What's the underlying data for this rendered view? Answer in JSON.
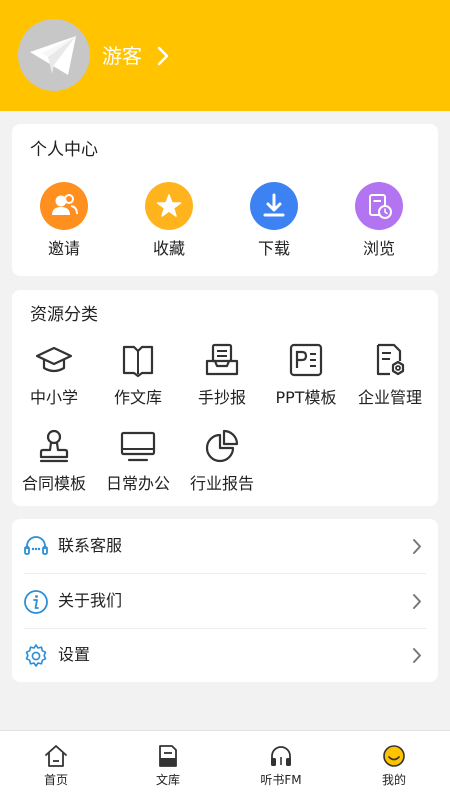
{
  "header": {
    "username": "游客"
  },
  "personal_center": {
    "title": "个人中心",
    "items": [
      {
        "label": "邀请",
        "color": "#ff8f1f"
      },
      {
        "label": "收藏",
        "color": "#ffb41e"
      },
      {
        "label": "下载",
        "color": "#3d82f2"
      },
      {
        "label": "浏览",
        "color": "#b274f0"
      }
    ]
  },
  "resources": {
    "title": "资源分类",
    "items": [
      {
        "label": "中小学"
      },
      {
        "label": "作文库"
      },
      {
        "label": "手抄报"
      },
      {
        "label": "PPT模板"
      },
      {
        "label": "企业管理"
      },
      {
        "label": "合同模板"
      },
      {
        "label": "日常办公"
      },
      {
        "label": "行业报告"
      }
    ]
  },
  "menu": {
    "items": [
      {
        "label": "联系客服"
      },
      {
        "label": "关于我们"
      },
      {
        "label": "设置"
      }
    ]
  },
  "tabbar": {
    "items": [
      {
        "label": "首页"
      },
      {
        "label": "文库"
      },
      {
        "label": "听书FM"
      },
      {
        "label": "我的"
      }
    ]
  },
  "colors": {
    "header": "#ffc300",
    "menu_icon": "#2a8fd6"
  }
}
